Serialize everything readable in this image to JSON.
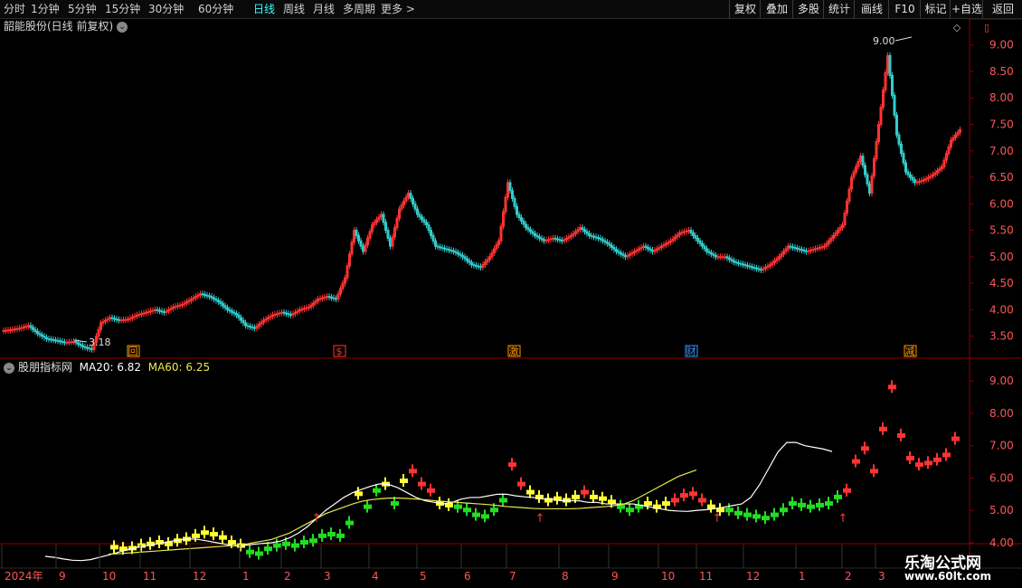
{
  "toolbar": {
    "periods": [
      "分时",
      "1分钟",
      "5分钟",
      "15分钟",
      "30分钟",
      "60分钟",
      "日线",
      "周线",
      "月线",
      "多周期",
      "更多 >"
    ],
    "active_period": "日线",
    "right_buttons": [
      "复权",
      "叠加",
      "多股",
      "统计",
      "画线",
      "F10",
      "标记",
      "+自选",
      "返回"
    ]
  },
  "main_chart": {
    "title": "韶能股份(日线 前复权)",
    "y_ticks": [
      "9.00",
      "8.50",
      "8.00",
      "7.50",
      "7.00",
      "6.50",
      "6.00",
      "5.50",
      "5.00",
      "4.50",
      "4.00",
      "3.50"
    ],
    "high_label": "9.00",
    "low_label": "3.18",
    "event_markers": [
      {
        "text": "回",
        "color": "#ff9900"
      },
      {
        "text": "$",
        "color": "#ff3333"
      },
      {
        "text": "激",
        "color": "#ff9900"
      },
      {
        "text": "财",
        "color": "#3399ff"
      },
      {
        "text": "减",
        "color": "#ff9900"
      }
    ]
  },
  "indicator_chart": {
    "name": "股朋指标网",
    "ma20_label": "MA20: 6.82",
    "ma60_label": "MA60: 6.25",
    "y_ticks": [
      "9.00",
      "8.00",
      "7.00",
      "6.00",
      "5.00",
      "4.00"
    ]
  },
  "x_axis": {
    "labels": [
      "2024年",
      "9",
      "10",
      "11",
      "12",
      "1",
      "2",
      "3",
      "4",
      "5",
      "6",
      "7",
      "8",
      "9",
      "10",
      "11",
      "12",
      "1",
      "2",
      "3"
    ]
  },
  "watermark": {
    "title": "乐淘公式网",
    "url": "www.60lt.com"
  },
  "colors": {
    "up": "#ff3333",
    "down": "#33cccc",
    "green": "#22dd22",
    "yellow": "#ffff33",
    "ma20": "#ffffff",
    "ma60": "#e8e84a",
    "grid": "#8b0000"
  },
  "chart_data": {
    "type": "candlestick",
    "description_units": "price (CNY), one key point per ~week of daily data",
    "x": [
      0,
      10,
      20,
      30,
      40,
      50,
      60,
      70,
      80,
      90,
      100,
      110,
      120,
      130,
      140,
      150,
      160,
      170,
      180,
      190,
      200,
      210,
      220,
      230,
      240,
      250,
      260,
      270,
      280,
      290,
      300,
      310,
      320,
      330,
      340,
      350,
      360,
      370,
      380,
      390,
      400,
      410,
      420,
      430,
      440,
      450,
      460,
      470,
      480,
      490,
      500,
      510,
      520,
      530,
      540,
      550,
      560,
      570,
      580,
      590,
      600,
      610,
      620,
      630,
      640,
      650,
      660,
      670,
      680,
      690,
      700,
      710,
      720,
      730,
      740,
      750,
      760,
      770,
      780,
      790,
      800,
      810,
      820,
      830,
      840,
      850,
      860,
      870,
      880,
      890,
      900,
      910,
      920,
      930,
      940,
      950,
      960,
      970,
      980,
      990,
      1000,
      1010,
      1020,
      1030,
      1040,
      1050,
      1060
    ],
    "close": [
      3.6,
      3.62,
      3.65,
      3.7,
      3.55,
      3.45,
      3.42,
      3.38,
      3.4,
      3.3,
      3.25,
      3.75,
      3.85,
      3.8,
      3.82,
      3.9,
      3.95,
      4.0,
      3.95,
      4.05,
      4.1,
      4.2,
      4.3,
      4.25,
      4.15,
      4.0,
      3.9,
      3.7,
      3.65,
      3.8,
      3.9,
      3.95,
      3.9,
      4.0,
      4.05,
      4.2,
      4.25,
      4.2,
      4.6,
      5.5,
      5.1,
      5.6,
      5.8,
      5.2,
      5.9,
      6.2,
      5.8,
      5.6,
      5.2,
      5.15,
      5.1,
      5.0,
      4.85,
      4.8,
      5.0,
      5.3,
      6.4,
      5.8,
      5.55,
      5.4,
      5.3,
      5.35,
      5.3,
      5.4,
      5.55,
      5.4,
      5.35,
      5.25,
      5.1,
      5.0,
      5.1,
      5.2,
      5.1,
      5.2,
      5.3,
      5.45,
      5.5,
      5.3,
      5.1,
      5.0,
      5.0,
      4.9,
      4.85,
      4.8,
      4.75,
      4.85,
      5.0,
      5.2,
      5.15,
      5.1,
      5.15,
      5.2,
      5.4,
      5.6,
      6.5,
      6.9,
      6.2,
      7.5,
      8.8,
      7.3,
      6.6,
      6.4,
      6.45,
      6.55,
      6.7,
      7.2,
      7.4
    ],
    "ma20": [
      null,
      null,
      null,
      null,
      null,
      3.58,
      3.55,
      3.5,
      3.46,
      3.45,
      3.48,
      3.55,
      3.62,
      3.7,
      3.78,
      3.85,
      3.9,
      3.95,
      4.0,
      4.05,
      4.1,
      4.12,
      4.1,
      4.05,
      4.0,
      3.95,
      3.9,
      3.92,
      3.95,
      3.98,
      4.0,
      4.05,
      4.15,
      4.3,
      4.5,
      4.75,
      5.0,
      5.2,
      5.4,
      5.55,
      5.65,
      5.75,
      5.82,
      5.8,
      5.7,
      5.55,
      5.4,
      5.3,
      5.25,
      5.2,
      5.25,
      5.35,
      5.4,
      5.4,
      5.45,
      5.5,
      5.5,
      5.45,
      5.42,
      5.4,
      5.35,
      5.35,
      5.3,
      5.3,
      5.3,
      5.25,
      5.25,
      5.2,
      5.2,
      5.2,
      5.2,
      5.15,
      5.1,
      5.05,
      5.0,
      4.98,
      4.97,
      5.0,
      5.02,
      5.05,
      5.1,
      5.15,
      5.2,
      5.4,
      5.8,
      6.3,
      6.8,
      7.1,
      7.1,
      7.0,
      6.95,
      6.9,
      6.82
    ],
    "ma60": [
      null,
      null,
      null,
      null,
      null,
      null,
      null,
      null,
      null,
      null,
      null,
      null,
      3.65,
      3.66,
      3.68,
      3.7,
      3.72,
      3.74,
      3.76,
      3.78,
      3.8,
      3.82,
      3.84,
      3.86,
      3.88,
      3.9,
      3.92,
      3.95,
      4.0,
      4.05,
      4.1,
      4.2,
      4.3,
      4.45,
      4.6,
      4.75,
      4.9,
      5.0,
      5.1,
      5.2,
      5.28,
      5.33,
      5.36,
      5.38,
      5.38,
      5.37,
      5.35,
      5.33,
      5.3,
      5.28,
      5.26,
      5.24,
      5.22,
      5.2,
      5.18,
      5.15,
      5.12,
      5.1,
      5.08,
      5.06,
      5.05,
      5.05,
      5.05,
      5.05,
      5.06,
      5.08,
      5.1,
      5.12,
      5.15,
      5.2,
      5.3,
      5.45,
      5.6,
      5.75,
      5.9,
      6.05,
      6.15,
      6.25
    ],
    "ylim_main": [
      3.1,
      9.2
    ],
    "ylim_indicator": [
      4.0,
      9.2
    ]
  }
}
